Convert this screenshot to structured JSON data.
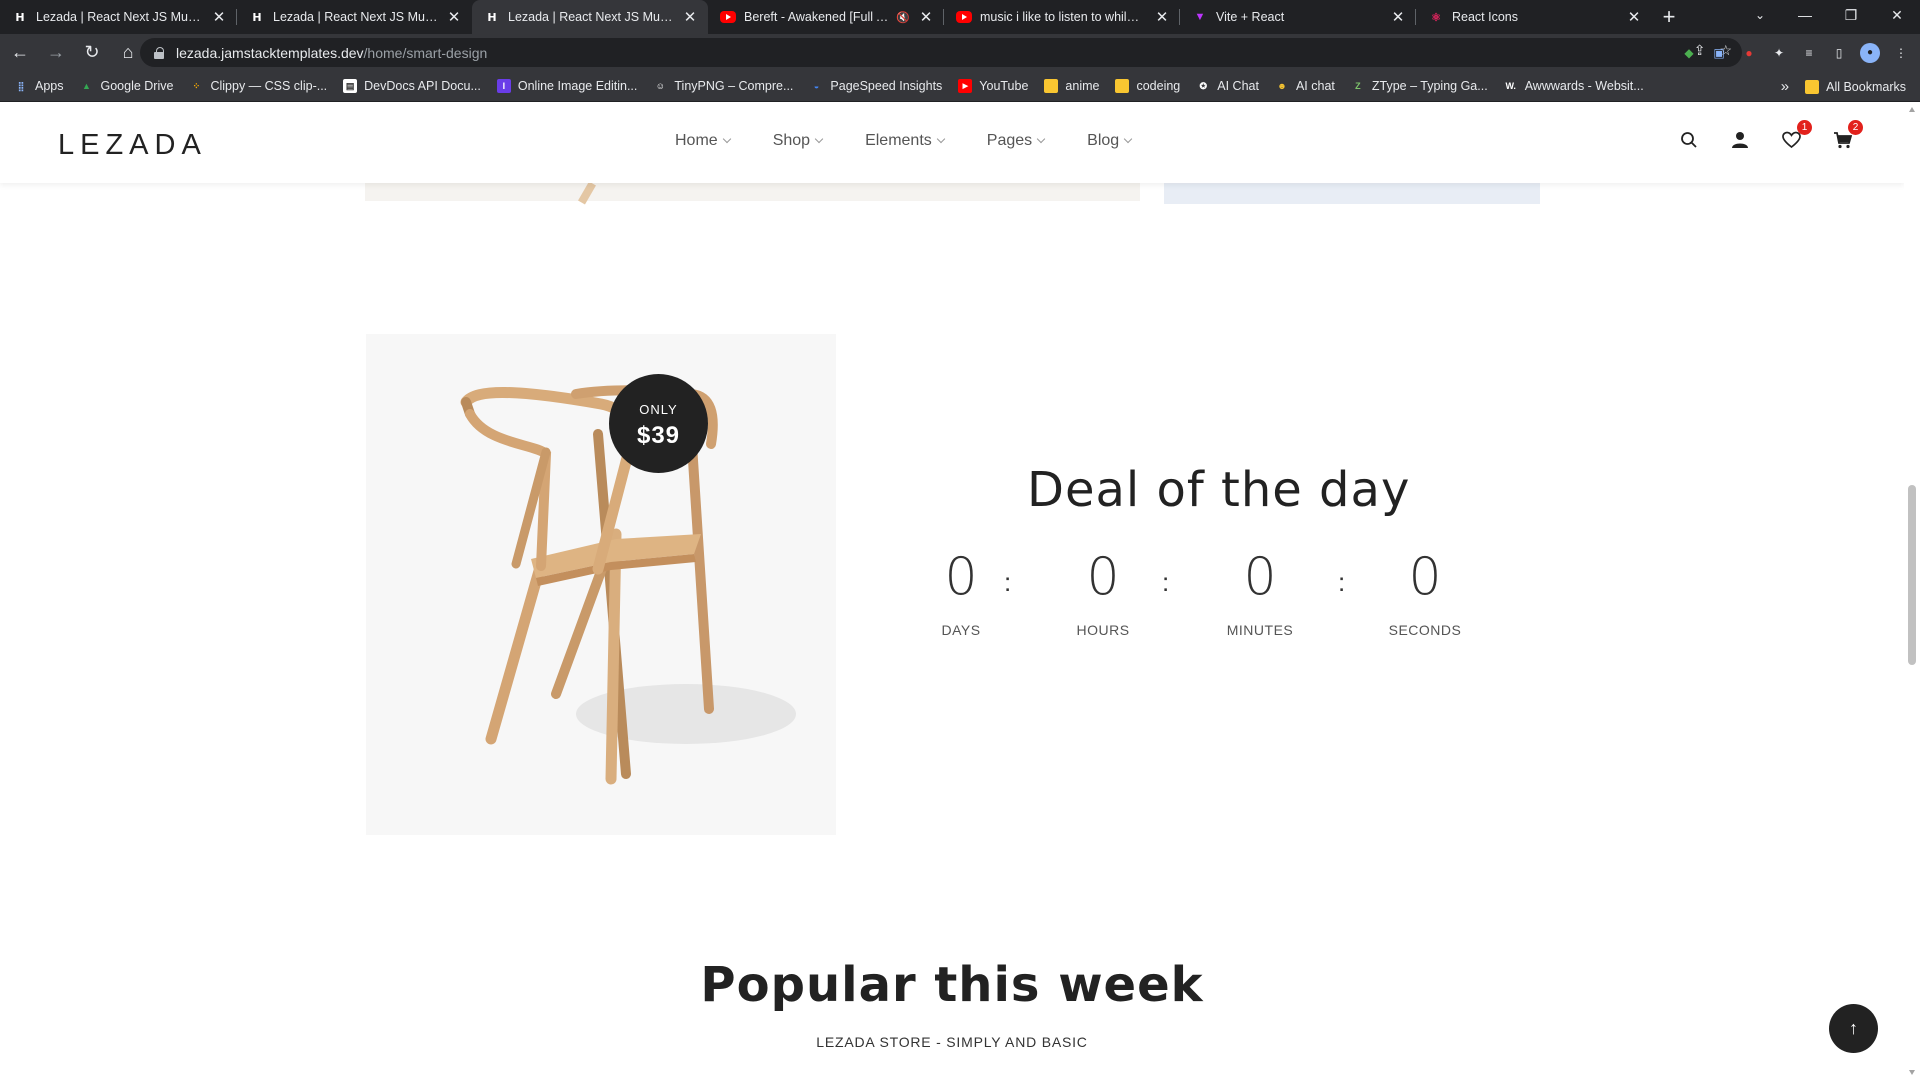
{
  "browser": {
    "tabs": [
      {
        "title": "Lezada | React Next JS Multipur",
        "favicon": "h-logo-icon",
        "active": false
      },
      {
        "title": "Lezada | React Next JS Multipur",
        "favicon": "h-logo-icon",
        "active": false
      },
      {
        "title": "Lezada | React Next JS Multipur",
        "favicon": "h-logo-icon",
        "active": true
      },
      {
        "title": "Bereft - Awakened [Full Alb",
        "favicon": "youtube-icon",
        "active": false
      },
      {
        "title": "music i like to listen to while co",
        "favicon": "youtube-icon",
        "active": false
      },
      {
        "title": "Vite + React",
        "favicon": "vite-icon",
        "active": false
      },
      {
        "title": "React Icons",
        "favicon": "react-icon",
        "active": false
      }
    ],
    "url_host": "lezada.jamstacktemplates.dev",
    "url_path": "/home/smart-design",
    "bookmarks": [
      {
        "label": "Apps",
        "icon": "apps-grid-icon"
      },
      {
        "label": "Google Drive",
        "icon": "google-drive-icon"
      },
      {
        "label": "Clippy — CSS clip-...",
        "icon": "clippy-icon"
      },
      {
        "label": "DevDocs API Docu...",
        "icon": "devdocs-icon"
      },
      {
        "label": "Online Image Editin...",
        "icon": "image-editor-icon"
      },
      {
        "label": "TinyPNG – Compre...",
        "icon": "tinypng-icon"
      },
      {
        "label": "PageSpeed Insights",
        "icon": "pagespeed-icon"
      },
      {
        "label": "YouTube",
        "icon": "youtube-icon"
      },
      {
        "label": "anime",
        "icon": "folder-icon"
      },
      {
        "label": "codeing",
        "icon": "folder-icon"
      },
      {
        "label": "AI Chat",
        "icon": "ai-chat-icon"
      },
      {
        "label": "AI chat",
        "icon": "ai-chat-icon"
      },
      {
        "label": "ZType – Typing Ga...",
        "icon": "ztype-icon"
      },
      {
        "label": "Awwwards - Websit...",
        "icon": "awwwards-icon"
      }
    ],
    "more_bookmarks": "»",
    "all_bookmarks": "All Bookmarks"
  },
  "site": {
    "logo": "LEZADA",
    "nav": [
      {
        "label": "Home"
      },
      {
        "label": "Shop"
      },
      {
        "label": "Elements"
      },
      {
        "label": "Pages"
      },
      {
        "label": "Blog"
      }
    ],
    "wishlist_count": "1",
    "cart_count": "2"
  },
  "deal": {
    "badge_only": "ONLY",
    "badge_price": "$39",
    "title": "Deal of the day",
    "countdown": [
      {
        "value": "0",
        "label": "DAYS"
      },
      {
        "value": "0",
        "label": "HOURS"
      },
      {
        "value": "0",
        "label": "MINUTES"
      },
      {
        "value": "0",
        "label": "SECONDS"
      }
    ],
    "separator": ":"
  },
  "popular": {
    "title": "Popular this week",
    "subtitle": "LEZADA STORE - SIMPLY AND BASIC"
  },
  "colors": {
    "accent_dark": "#222222",
    "badge_red": "#e2211c",
    "chrome_dark": "#202124"
  }
}
